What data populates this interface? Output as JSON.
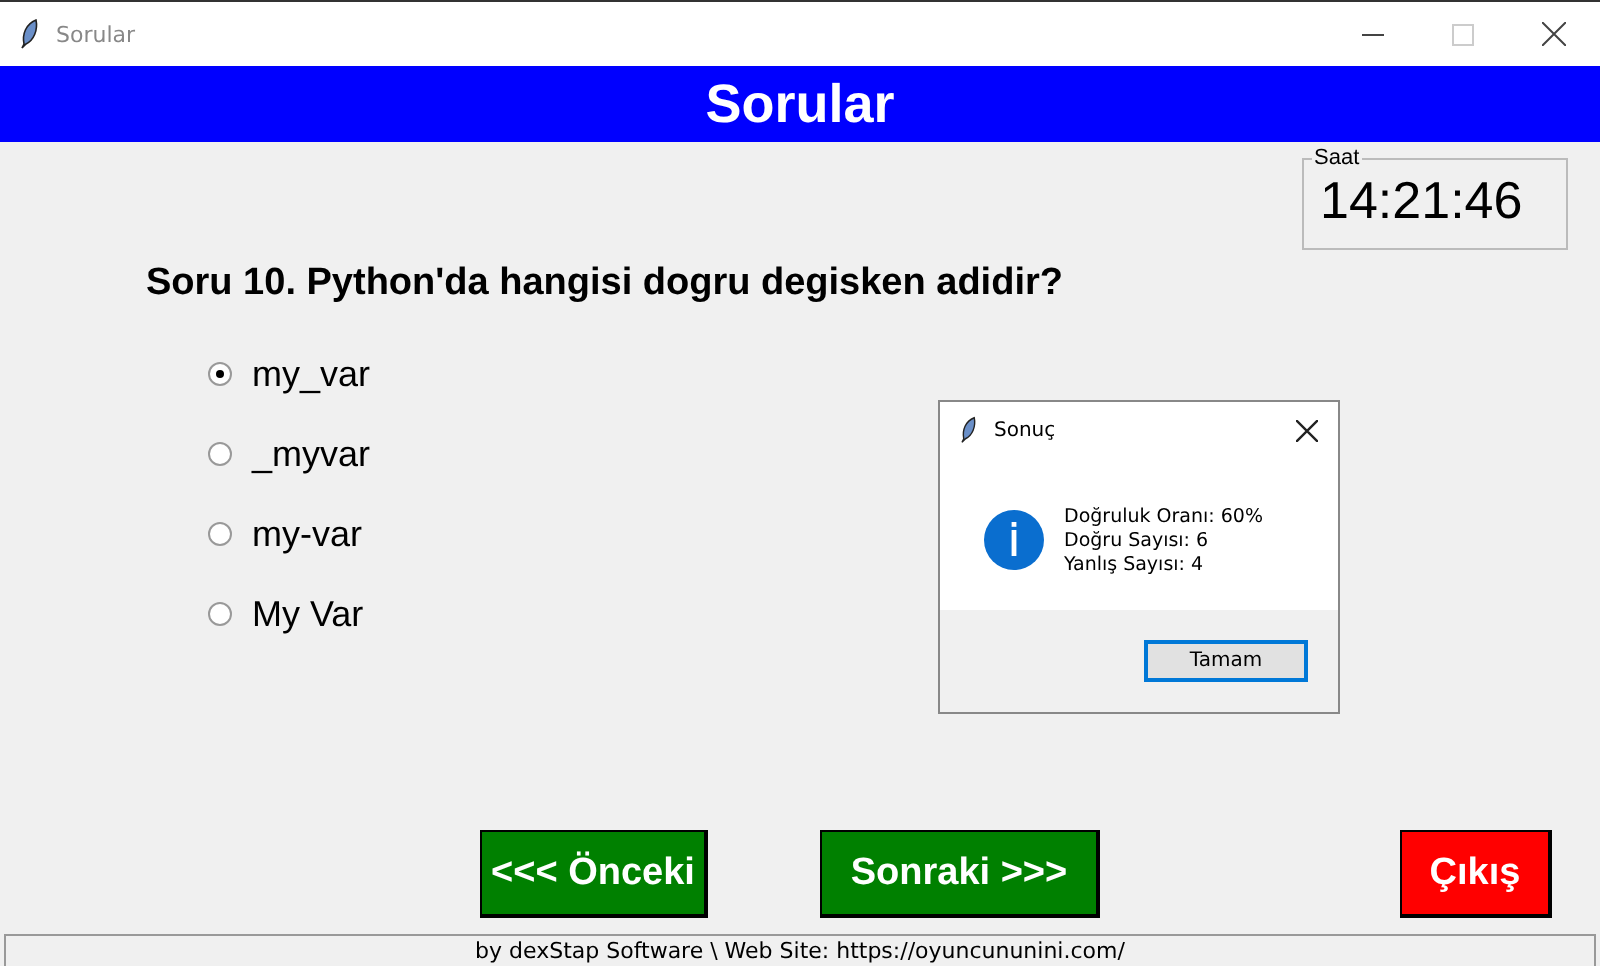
{
  "window": {
    "title": "Sorular"
  },
  "header": {
    "title": "Sorular"
  },
  "clock": {
    "label": "Saat",
    "time": "14:21:46"
  },
  "question": {
    "text": "Soru 10. Python'da hangisi dogru degisken adidir?"
  },
  "options": [
    {
      "label": "my_var",
      "selected": true
    },
    {
      "label": "_myvar",
      "selected": false
    },
    {
      "label": "my-var",
      "selected": false
    },
    {
      "label": "My Var",
      "selected": false
    }
  ],
  "dialog": {
    "title": "Sonuç",
    "lines": [
      "Doğruluk Oranı: 60%",
      "Doğru Sayısı: 6",
      "Yanlış Sayısı: 4"
    ],
    "button": "Tamam"
  },
  "buttons": [
    {
      "label": "<<< Önceki",
      "color": "#008000"
    },
    {
      "label": "Sonraki >>>",
      "color": "#008000"
    },
    {
      "label": "Çıkış",
      "color": "#ff0000"
    }
  ],
  "status_bar": {
    "text": "by dexStap Software \\ Web Site: https://oyuncununini.com/"
  }
}
